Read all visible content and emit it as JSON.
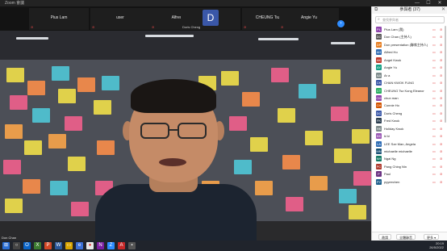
{
  "window": {
    "title": "Zoom 會議",
    "min": "—",
    "max": "☐",
    "close": "✕"
  },
  "gallery": {
    "tiles": [
      {
        "name": "Pius Lam"
      },
      {
        "name": "user"
      },
      {
        "name": "Alfred Ho"
      },
      {
        "name": "Doris Cheng",
        "initial": "D"
      },
      {
        "name": "CHEUNG Tsz Ki..."
      },
      {
        "name": "Angie Yu"
      }
    ],
    "next": "›"
  },
  "video": {
    "speaker": "Don Chan"
  },
  "panel": {
    "title": "參與者 (37)",
    "close": "✕",
    "popout": "⧉",
    "search_placeholder": "查找參與者",
    "search_icon": "magnifier-icon",
    "participants": [
      {
        "initial": "PL",
        "name": "Pius Lam (我)",
        "color": "#8e44ad"
      },
      {
        "initial": "DC",
        "name": "Don Chan (主持人)",
        "color": "#5a5a5a"
      },
      {
        "initial": "DP",
        "name": "Don presentation (聯席主持人)",
        "color": "#e67e22"
      },
      {
        "initial": "AH",
        "name": "Alfred Ho",
        "color": "#2f6db5"
      },
      {
        "initial": "AK",
        "name": "Angel Kwok",
        "color": "#c0392b"
      },
      {
        "initial": "AY",
        "name": "Angie Yu",
        "color": "#16a085"
      },
      {
        "initial": "AA",
        "name": "Ar a",
        "color": "#7f8c8d"
      },
      {
        "initial": "CK",
        "name": "CHAN KWOK FUNG",
        "color": "#3a57a8"
      },
      {
        "initial": "CT",
        "name": "CHEUNG Tsz Kong Eleanor",
        "color": "#27ae60"
      },
      {
        "initial": "CM",
        "name": "chun man",
        "color": "#8e44ad"
      },
      {
        "initial": "CH",
        "name": "Connie Ho",
        "color": "#d35400"
      },
      {
        "initial": "DC",
        "name": "Doris Cheng",
        "color": "#3a57a8"
      },
      {
        "initial": "FK",
        "name": "Fred Kwok",
        "color": "#2c3e50"
      },
      {
        "initial": "HK",
        "name": "Holiday Kwok",
        "color": "#7f8c8d"
      },
      {
        "initial": "KK",
        "name": "ki ki",
        "color": "#9b59b6"
      },
      {
        "initial": "LA",
        "name": "LEE Sze Man, Angela",
        "color": "#2f6db5"
      },
      {
        "initial": "MN",
        "name": "michaelle michaelle",
        "color": "#1a5276"
      },
      {
        "initial": "NH",
        "name": "Ngai Ng",
        "color": "#117a65"
      },
      {
        "initial": "PC",
        "name": "Pang Ching Nin",
        "color": "#b03a2e"
      },
      {
        "initial": "P",
        "name": "Paul",
        "color": "#6c3483"
      },
      {
        "initial": "PY",
        "name": "pyyeechen",
        "color": "#1f618d"
      }
    ],
    "footer": {
      "invite": "邀請",
      "mute_all": "全體靜音",
      "more": "更多 ▾"
    }
  },
  "taskbar": {
    "start_icon": "windows-start-icon",
    "time": "20:19",
    "date": "26/5/2022"
  }
}
